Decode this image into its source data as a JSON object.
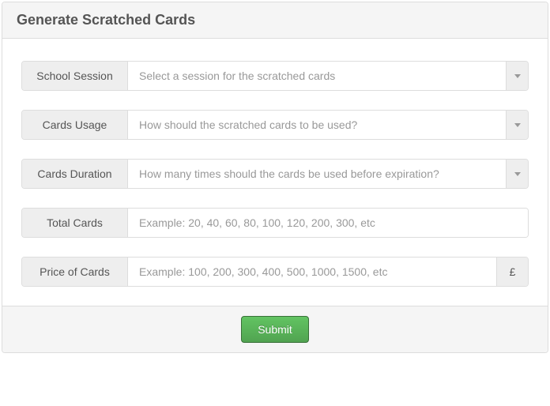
{
  "header": {
    "title": "Generate Scratched Cards"
  },
  "form": {
    "school_session": {
      "label": "School Session",
      "placeholder": "Select a session for the scratched cards"
    },
    "cards_usage": {
      "label": "Cards Usage",
      "placeholder": "How should the scratched cards to be used?"
    },
    "cards_duration": {
      "label": "Cards Duration",
      "placeholder": "How many times should the cards be used before expiration?"
    },
    "total_cards": {
      "label": "Total Cards",
      "placeholder": "Example: 20, 40, 60, 80, 100, 120, 200, 300, etc"
    },
    "price_of_cards": {
      "label": "Price of Cards",
      "placeholder": "Example: 100, 200, 300, 400, 500, 1000, 1500, etc",
      "currency": "£"
    }
  },
  "footer": {
    "submit_label": "Submit"
  }
}
